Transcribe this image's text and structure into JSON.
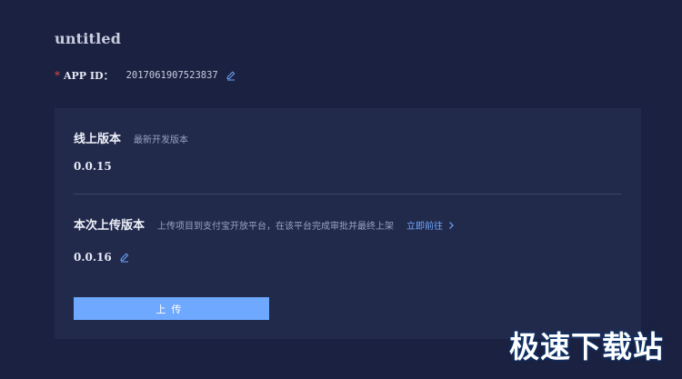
{
  "page": {
    "title": "untitled"
  },
  "app_id": {
    "required_mark": "*",
    "label": "APP ID：",
    "value": "2017061907523837",
    "edit_icon": "pencil-icon"
  },
  "online": {
    "title": "线上版本",
    "description": "最新开发版本",
    "version": "0.0.15"
  },
  "upload": {
    "title": "本次上传版本",
    "description": "上传项目到支付宝开放平台，在该平台完成审批并最终上架",
    "link_label": "立即前往",
    "link_icon": "chevron-right-icon",
    "version": "0.0.16",
    "edit_icon": "pencil-icon",
    "button_label": "上传"
  },
  "watermark": {
    "text": "极速下载站"
  },
  "colors": {
    "background": "#1b2140",
    "panel": "#222a4c",
    "accent": "#6fa8ff",
    "link": "#6ea8ff",
    "required": "#e0464b"
  }
}
